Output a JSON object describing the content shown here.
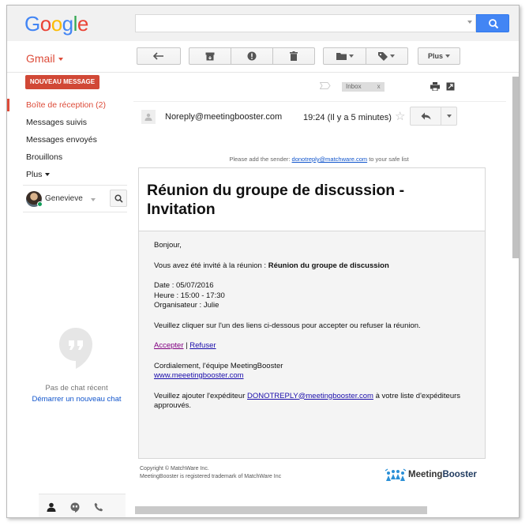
{
  "header": {
    "logo_letters": [
      {
        "ch": "G",
        "color": "#4285f4"
      },
      {
        "ch": "o",
        "color": "#ea4335"
      },
      {
        "ch": "o",
        "color": "#fbbc05"
      },
      {
        "ch": "g",
        "color": "#4285f4"
      },
      {
        "ch": "l",
        "color": "#34a853"
      },
      {
        "ch": "e",
        "color": "#ea4335"
      }
    ],
    "search_value": "",
    "search_icon": "search-icon"
  },
  "toolbar": {
    "app_label": "Gmail",
    "back_icon": "back-arrow-icon",
    "archive_icon": "archive-icon",
    "spam_icon": "report-spam-icon",
    "delete_icon": "trash-icon",
    "move_icon": "folder-icon",
    "labels_icon": "label-icon",
    "more_label": "Plus"
  },
  "sidebar": {
    "compose_label": "NOUVEAU MESSAGE",
    "items": [
      {
        "label": "Boîte de réception (2)",
        "active": true
      },
      {
        "label": "Messages suivis",
        "active": false
      },
      {
        "label": "Messages envoyés",
        "active": false
      },
      {
        "label": "Brouillons",
        "active": false
      },
      {
        "label": "Plus",
        "active": false
      }
    ],
    "user_name": "Genevieve",
    "chat_empty": "Pas de chat récent",
    "chat_start": "Démarrer un nouveau chat",
    "bottom_icons": [
      "person-icon",
      "hangouts-icon",
      "phone-icon"
    ]
  },
  "message": {
    "label_tag": "Inbox",
    "label_remove": "x",
    "sender": "Noreply@meetingbooster.com",
    "time": "19:24 (Il y a 5 minutes)",
    "safelist_prefix": "Please add the sender:",
    "safelist_email": "donotreply@matchware.com",
    "safelist_suffix": "to your safe list"
  },
  "email": {
    "title": "Réunion du groupe de discussion - Invitation",
    "greeting": "Bonjour,",
    "invited_prefix": "Vous avez été invité à la réunion : ",
    "invited_meeting": "Réunion du groupe de discussion",
    "date": "Date : 05/07/2016",
    "time": "Heure : 15:00 - 17:30",
    "organizer": "Organisateur : Julie",
    "instruction": "Veuillez cliquer sur l'un des liens ci-dessous pour accepter ou refuser la réunion.",
    "accept": "Accepter",
    "link_sep": " | ",
    "refuse": "Refuser",
    "signature": "Cordialement, l'équipe MeetingBooster",
    "website": "www.meeetingbooster.com",
    "add_sender_prefix": "Veuillez ajouter l'expéditeur ",
    "add_sender_email": "DONOTREPLY@meetingbooster.com",
    "add_sender_suffix": " à votre liste d'expéditeurs approuvés."
  },
  "footer": {
    "copyright": "Copyright © MatchWare Inc.",
    "trademark": "MeetingBooster is registered trademark of MatchWare Inc",
    "logo_text_1": "Meeting",
    "logo_text_2": "Booster"
  },
  "colors": {
    "brand_red": "#dd4b39",
    "compose_red": "#d14836",
    "search_blue": "#4285f4",
    "link_blue": "#1155cc"
  }
}
